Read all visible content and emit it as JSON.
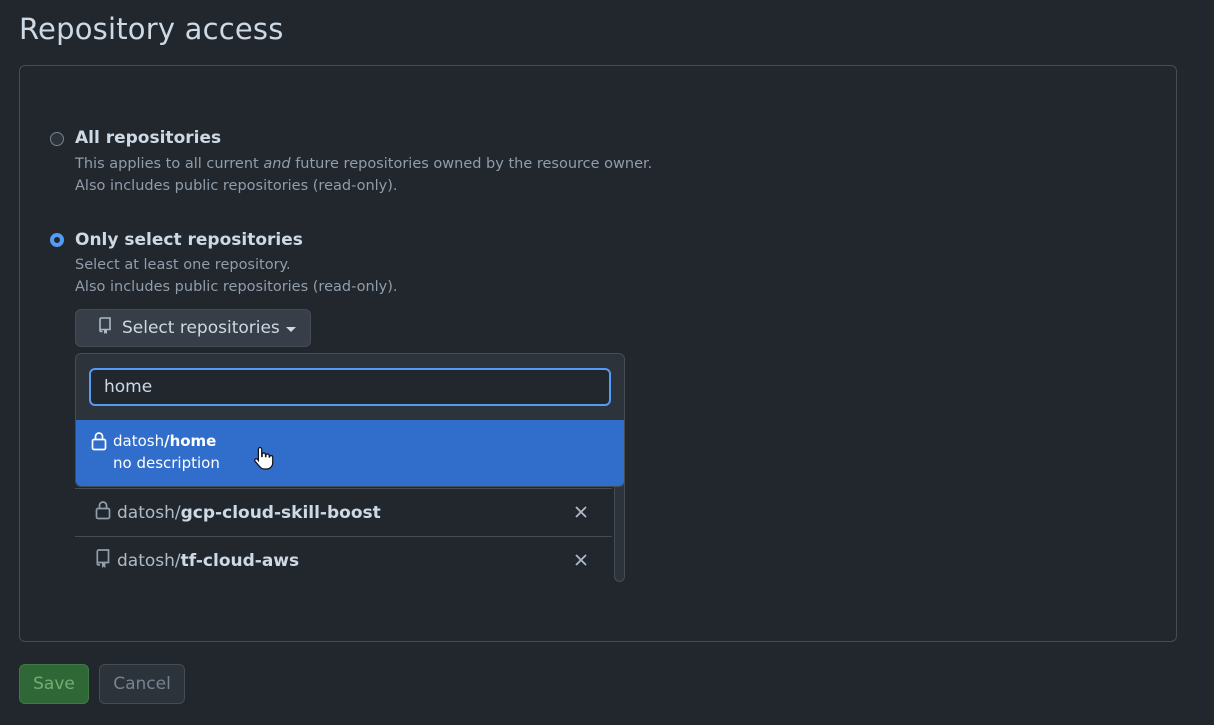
{
  "page": {
    "title": "Repository access"
  },
  "options": {
    "all": {
      "label": "All repositories",
      "desc_before": "This applies to all current ",
      "desc_em": "and",
      "desc_after": " future repositories owned by the resource owner.",
      "desc2": "Also includes public repositories (read-only).",
      "selected": false
    },
    "select": {
      "label": "Only select repositories",
      "desc1": "Select at least one repository.",
      "desc2": "Also includes public repositories (read-only).",
      "selected": true
    }
  },
  "select_button": {
    "label": "Select repositories",
    "icon": "repo-icon"
  },
  "dropdown": {
    "filter_value": "home",
    "results": [
      {
        "owner": "datosh",
        "repo": "/home",
        "description": "no description",
        "icon": "lock-icon"
      }
    ]
  },
  "selected_repos": [
    {
      "owner": "datosh/",
      "repo": "gcp-cloud-skill-boost",
      "icon": "lock-icon"
    },
    {
      "owner": "datosh/",
      "repo": "tf-cloud-aws",
      "icon": "repo-icon"
    }
  ],
  "actions": {
    "save": "Save",
    "cancel": "Cancel"
  },
  "colors": {
    "accent": "#539bf5",
    "highlight": "#316dca",
    "save": "#347d39"
  }
}
